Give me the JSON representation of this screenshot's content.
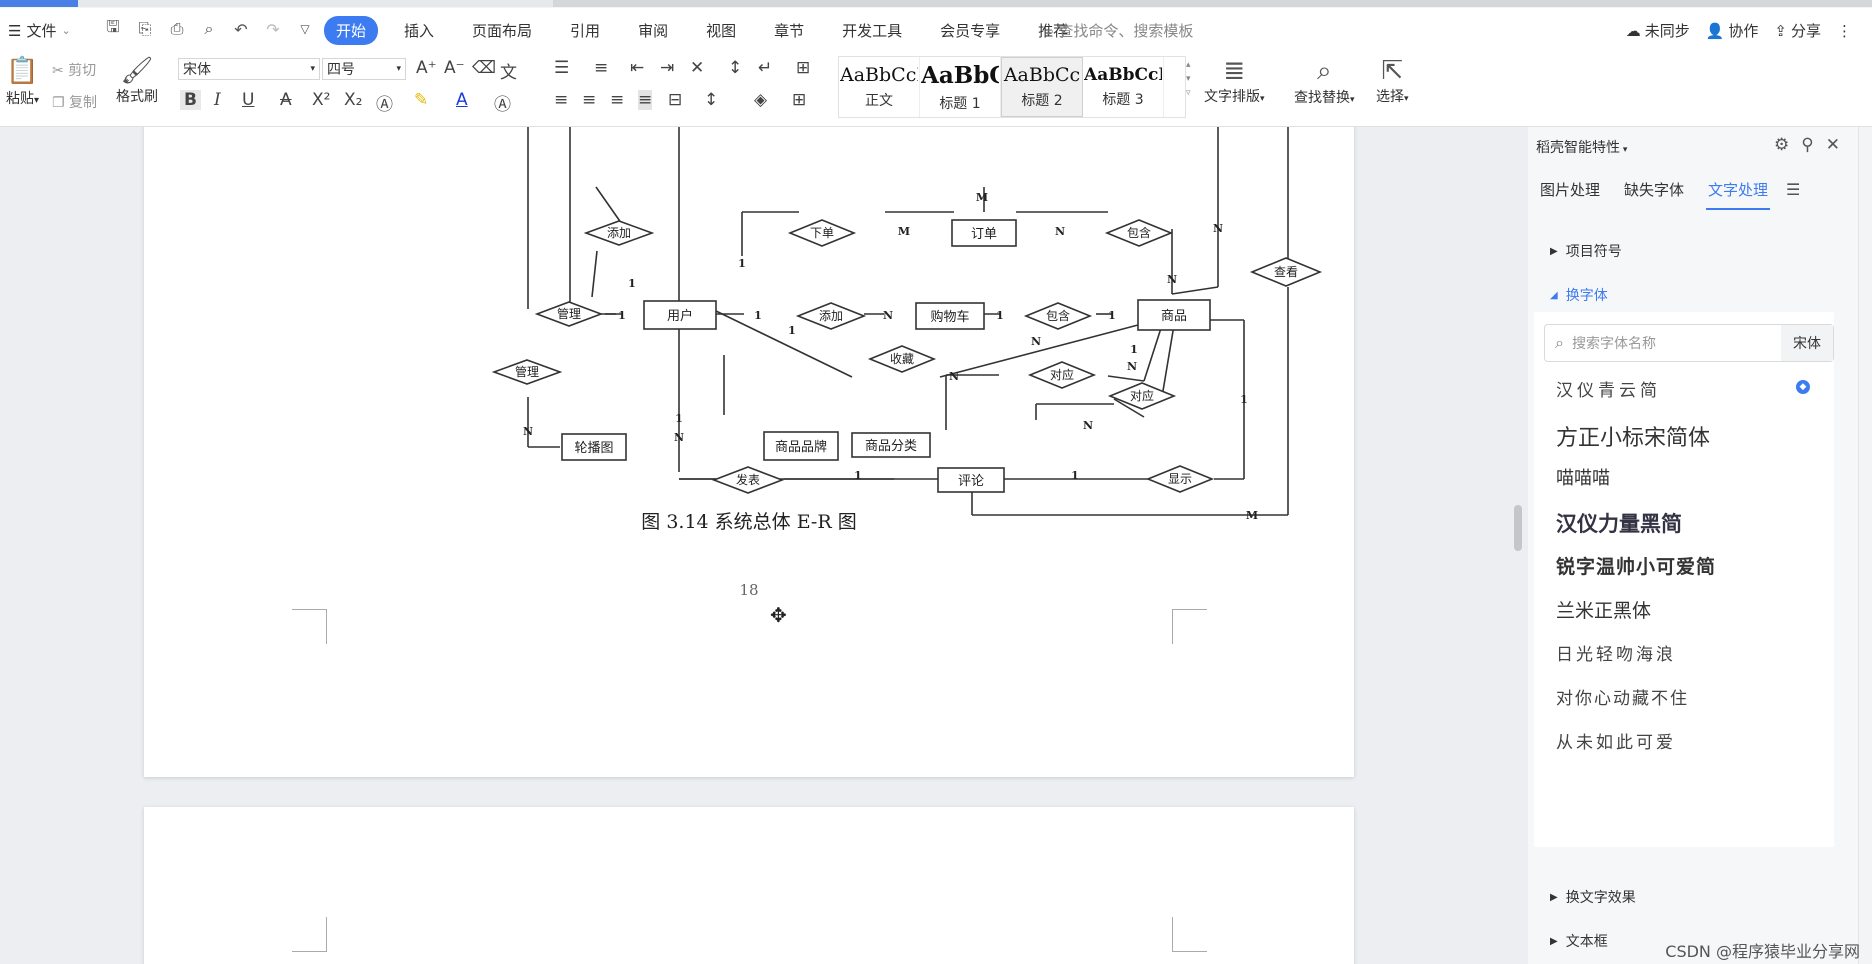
{
  "menubar": {
    "file_label": "文件",
    "tabs": [
      "开始",
      "插入",
      "页面布局",
      "引用",
      "审阅",
      "视图",
      "章节",
      "开发工具",
      "会员专享",
      "推荐"
    ],
    "active_tab": "开始",
    "search_placeholder": "查找命令、搜索模板",
    "right": {
      "sync": "未同步",
      "collab": "协作",
      "share": "分享"
    }
  },
  "ribbon": {
    "paste": "粘贴",
    "cut": "剪切",
    "copy": "复制",
    "format_painter": "格式刷",
    "font_name": "宋体",
    "font_size": "四号",
    "styles": [
      {
        "preview": "AaBbCcI",
        "name": "正文"
      },
      {
        "preview": "AaBbC",
        "name": "标题 1"
      },
      {
        "preview": "AaBbCc",
        "name": "标题 2"
      },
      {
        "preview": "AaBbCcI",
        "name": "标题 3"
      }
    ],
    "text_layout": "文字排版",
    "find_replace": "查找替换",
    "select": "选择"
  },
  "document": {
    "caption": "图 3.14  系统总体 E-R 图",
    "page_number": "18",
    "er": {
      "entities": [
        "用户",
        "订单",
        "购物车",
        "商品",
        "轮播图",
        "商品品牌",
        "商品分类",
        "评论"
      ],
      "relations": [
        "添加",
        "下单",
        "包含",
        "管理",
        "添加",
        "包含",
        "收藏",
        "对应",
        "对应",
        "管理",
        "查看",
        "发表",
        "显示"
      ],
      "cardinalities": [
        "1",
        "1",
        "M",
        "N",
        "N",
        "M",
        "1",
        "N",
        "1",
        "1",
        "1",
        "N",
        "1",
        "N",
        "1",
        "1",
        "N",
        "N",
        "1",
        "1",
        "N",
        "1",
        "1",
        "N",
        "N",
        "M"
      ]
    }
  },
  "panel": {
    "title": "稻壳智能特性",
    "tabs": [
      "图片处理",
      "缺失字体",
      "文字处理"
    ],
    "active_tab": "文字处理",
    "sections": {
      "bullets": "项目符号",
      "change_font": "换字体",
      "text_effect": "换文字效果",
      "text_box": "文本框"
    },
    "font_search_placeholder": "搜索字体名称",
    "current_font": "宋体",
    "fonts": [
      "汉仪青云简",
      "方正小标宋简体",
      "喵喵喵",
      "汉仪力量黑简",
      "锐字温帅小可爱简",
      "兰米正黑体",
      "日光轻吻海浪",
      "对你心动藏不住",
      "从未如此可爱"
    ]
  },
  "watermark": "CSDN @程序猿毕业分享网"
}
